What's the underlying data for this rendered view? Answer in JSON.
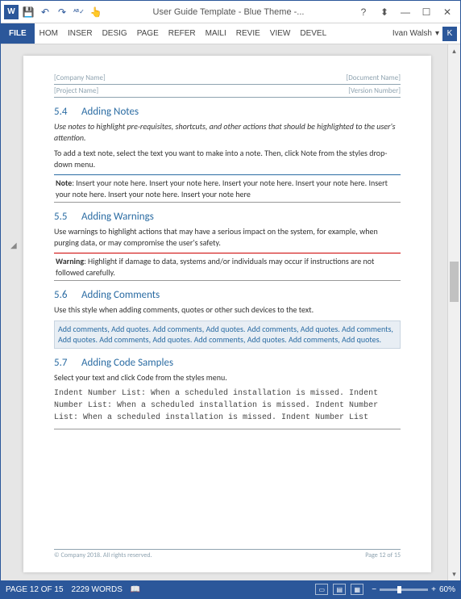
{
  "title": "User Guide Template - Blue Theme -...",
  "qat": {
    "save": "💾",
    "undo": "↶",
    "redo": "↷",
    "spell": "ᴬᴮ✓",
    "touch": "👆"
  },
  "tabs": [
    "HOM",
    "INSER",
    "DESIG",
    "PAGE",
    "REFER",
    "MAILI",
    "REVIE",
    "VIEW",
    "DEVEL"
  ],
  "file_label": "FILE",
  "user": "Ivan Walsh",
  "user_initial": "K",
  "header": {
    "left1": "[Company Name]",
    "right1": "[Document Name]",
    "left2": "[Project Name]",
    "right2": "[Version Number]"
  },
  "sections": {
    "s54": {
      "num": "5.4",
      "title": "Adding Notes",
      "intro": "Use notes to highlight pre-requisites, shortcuts, and other actions that should be highlighted to the user's attention.",
      "body": "To add a text note, select the text you want to make into a note. Then, click Note from the styles drop-down menu.",
      "box_label": "Note",
      "box_text": ": Insert your note here. Insert your note here. Insert your note here. Insert your note here. Insert your note here. Insert your note here. Insert your note here"
    },
    "s55": {
      "num": "5.5",
      "title": "Adding Warnings",
      "body": "Use warnings to highlight actions that may have a serious impact on the system, for example, when purging data, or may compromise the user's safety.",
      "box_label": "Warning",
      "box_text": ": Highlight if damage to data, systems and/or individuals may occur if instructions are not followed carefully."
    },
    "s56": {
      "num": "5.6",
      "title": "Adding Comments",
      "body": "Use this style when adding comments, quotes or other such devices to the text.",
      "box_text": "Add comments, Add quotes. Add comments, Add quotes. Add comments, Add quotes. Add comments, Add quotes. Add comments, Add quotes. Add comments, Add quotes. Add comments, Add quotes."
    },
    "s57": {
      "num": "5.7",
      "title": "Adding Code Samples",
      "body": "Select your text and click Code from the styles menu.",
      "box_text": "Indent Number List: When a scheduled installation is missed. Indent Number List: When a scheduled installation is missed. Indent Number List: When a scheduled installation is missed. Indent Number List"
    }
  },
  "footer": {
    "left": "© Company 2018. All rights reserved.",
    "right": "Page 12 of 15"
  },
  "status": {
    "page": "PAGE 12 OF 15",
    "words": "2229 WORDS",
    "zoom": "60%"
  }
}
